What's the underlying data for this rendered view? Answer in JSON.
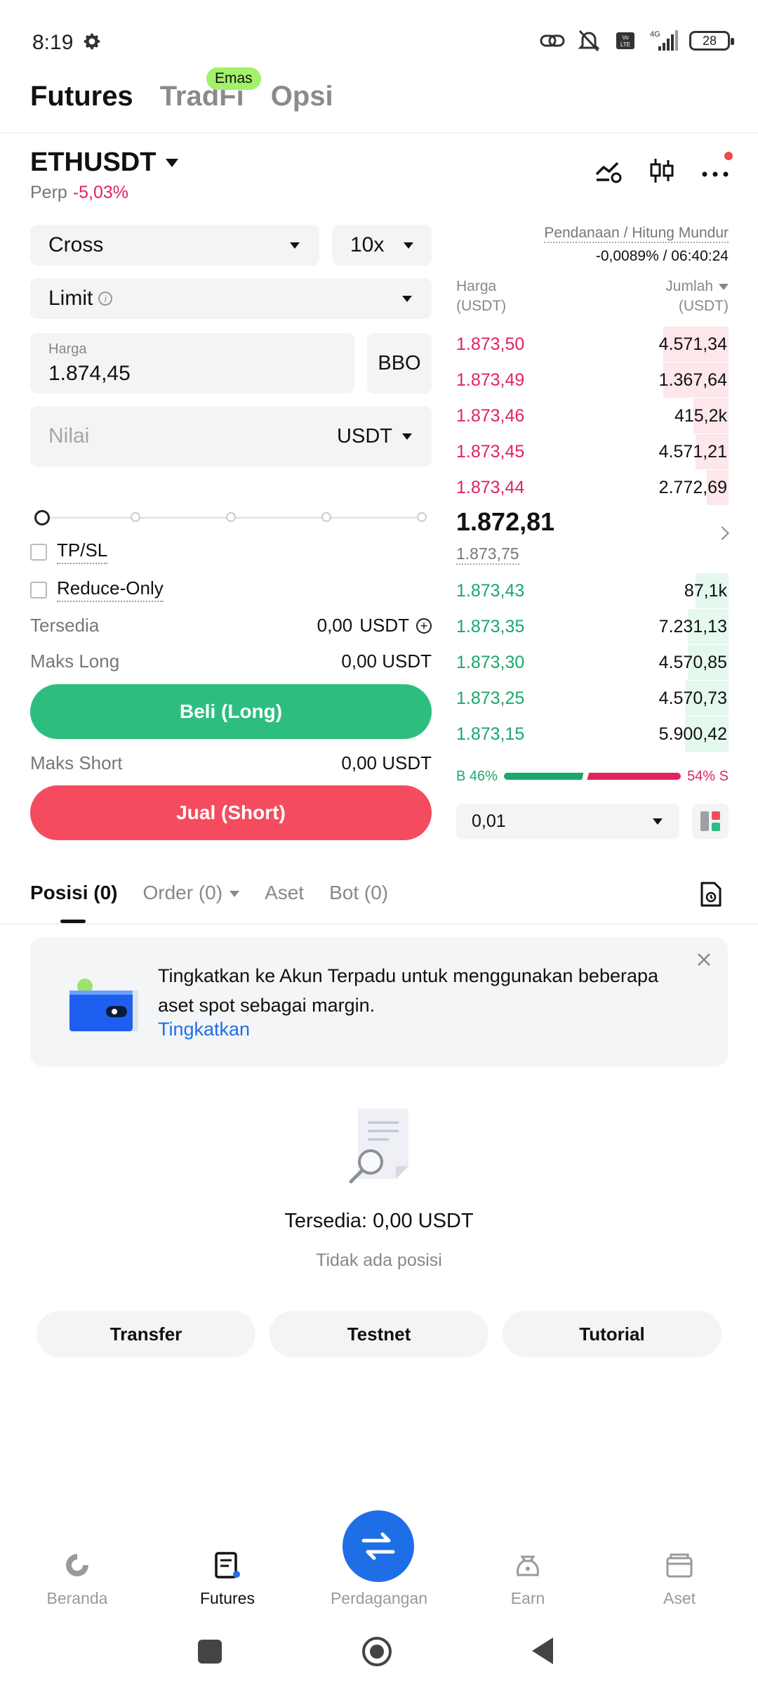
{
  "status_bar": {
    "time": "8:19",
    "network": "4G",
    "volte": "Vo LTE",
    "battery": "28"
  },
  "top_tabs": [
    {
      "label": "Futures"
    },
    {
      "label": "TradFi"
    },
    {
      "label": "Opsi"
    }
  ],
  "emas_badge": "Emas",
  "pair": {
    "name": "ETHUSDT",
    "type": "Perp",
    "change": "-5,03%"
  },
  "form": {
    "margin_mode": "Cross",
    "leverage": "10x",
    "order_type": "Limit",
    "info_glyph": "i",
    "price_label": "Harga",
    "price_value": "1.874,45",
    "bbo_label": "BBO",
    "value_placeholder": "Nilai",
    "value_unit": "USDT",
    "tpsl_label": "TP/SL",
    "reduce_only_label": "Reduce-Only",
    "available_label": "Tersedia",
    "available_value": "0,00",
    "available_unit": "USDT",
    "max_long_label": "Maks Long",
    "max_long_value": "0,00 USDT",
    "buy_label": "Beli (Long)",
    "max_short_label": "Maks Short",
    "max_short_value": "0,00 USDT",
    "sell_label": "Jual (Short)"
  },
  "order_book": {
    "funding_label": "Pendanaan / Hitung Mundur",
    "funding_value": "-0,0089% / 06:40:24",
    "header_price_1": "Harga",
    "header_price_2": "(USDT)",
    "header_qty_1": "Jumlah",
    "header_qty_2": "(USDT)",
    "asks": [
      {
        "price": "1.873,50",
        "qty": "4.571,34",
        "depth": 0.24
      },
      {
        "price": "1.873,49",
        "qty": "1.367,64",
        "depth": 0.24
      },
      {
        "price": "1.873,46",
        "qty": "415,2k",
        "depth": 0.13
      },
      {
        "price": "1.873,45",
        "qty": "4.571,21",
        "depth": 0.12
      },
      {
        "price": "1.873,44",
        "qty": "2.772,69",
        "depth": 0.08
      }
    ],
    "mid_price": "1.872,81",
    "mark_price": "1.873,75",
    "bids": [
      {
        "price": "1.873,43",
        "qty": "87,1k",
        "depth": 0.12
      },
      {
        "price": "1.873,35",
        "qty": "7.231,13",
        "depth": 0.15
      },
      {
        "price": "1.873,30",
        "qty": "4.570,85",
        "depth": 0.15
      },
      {
        "price": "1.873,25",
        "qty": "4.570,73",
        "depth": 0.16
      },
      {
        "price": "1.873,15",
        "qty": "5.900,42",
        "depth": 0.16
      }
    ],
    "buy_ratio": "B 46%",
    "sell_ratio": "54% S",
    "buy_pct": 46,
    "sell_pct": 54,
    "precision": "0,01"
  },
  "position_tabs": [
    {
      "label": "Posisi (0)"
    },
    {
      "label": "Order (0)"
    },
    {
      "label": "Aset"
    },
    {
      "label": "Bot (0)"
    }
  ],
  "banner": {
    "text": "Tingkatkan ke Akun Terpadu untuk menggunakan beberapa aset spot sebagai margin.",
    "link": "Tingkatkan"
  },
  "empty_state": {
    "available": "Tersedia: 0,00 USDT",
    "message": "Tidak ada posisi"
  },
  "actions": {
    "transfer": "Transfer",
    "testnet": "Testnet",
    "tutorial": "Tutorial"
  },
  "bottom_nav": [
    {
      "label": "Beranda"
    },
    {
      "label": "Futures"
    },
    {
      "label": "Perdagangan"
    },
    {
      "label": "Earn"
    },
    {
      "label": "Aset"
    }
  ],
  "colors": {
    "buy": "#2dbe7f",
    "sell": "#f44c5e",
    "accent": "#1e6fe6",
    "badge": "#a3f06b"
  }
}
